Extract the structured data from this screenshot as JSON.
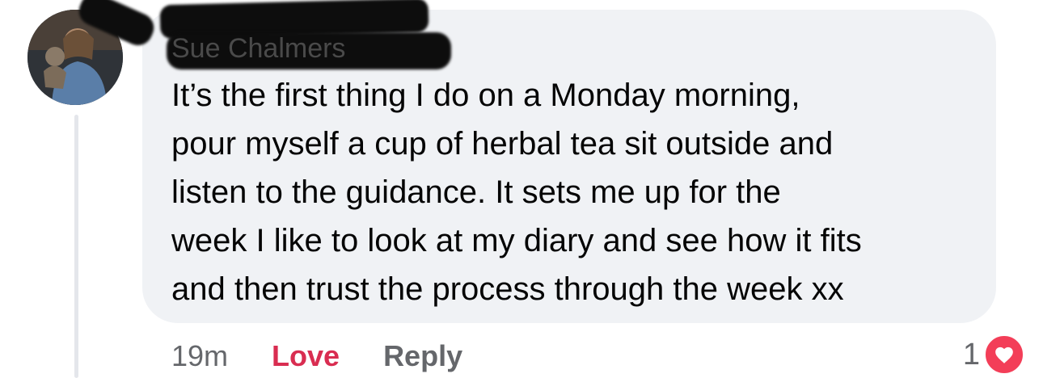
{
  "comment": {
    "author": "Sue Chalmers",
    "lines": [
      "It’s the first thing I do on a Monday morning,",
      "pour myself a cup of herbal tea sit outside and",
      "listen to the guidance.  It sets me up for the",
      "week I like to look at my diary and see how it fits",
      "and then trust the process through the week xx"
    ],
    "timestamp": "19m",
    "reaction_label": "Love",
    "reply_label": "Reply",
    "reaction_count": "1",
    "reaction_icon": "heart-icon"
  },
  "colors": {
    "bubble": "#f0f2f5",
    "love_red": "#d92d51",
    "heart_badge": "#f33e58",
    "muted_text": "#65676b"
  }
}
